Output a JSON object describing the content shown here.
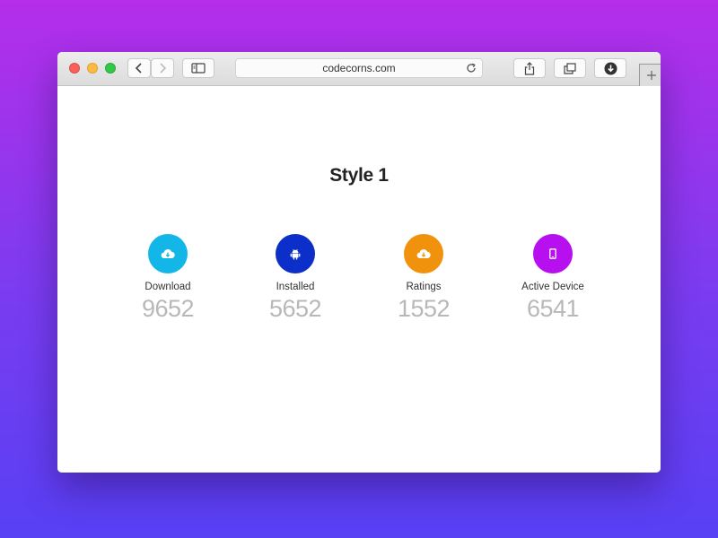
{
  "browser": {
    "url": "codecorns.com",
    "icons": {
      "back": "chevron-left-icon",
      "forward": "chevron-right-icon",
      "sidebar": "sidebar-icon",
      "reload": "reload-icon",
      "share": "share-icon",
      "tabs": "tabs-icon",
      "download": "download-icon",
      "new_tab": "plus-icon"
    }
  },
  "page": {
    "title": "Style 1"
  },
  "stats": [
    {
      "label": "Download",
      "value": "9652",
      "color": "#12b7e8",
      "icon": "cloud-download-icon"
    },
    {
      "label": "Installed",
      "value": "5652",
      "color": "#0b2fc8",
      "icon": "android-icon"
    },
    {
      "label": "Ratings",
      "value": "1552",
      "color": "#f0920c",
      "icon": "cloud-download-icon"
    },
    {
      "label": "Active Device",
      "value": "6541",
      "color": "#b80ff0",
      "icon": "mobile-icon"
    }
  ]
}
